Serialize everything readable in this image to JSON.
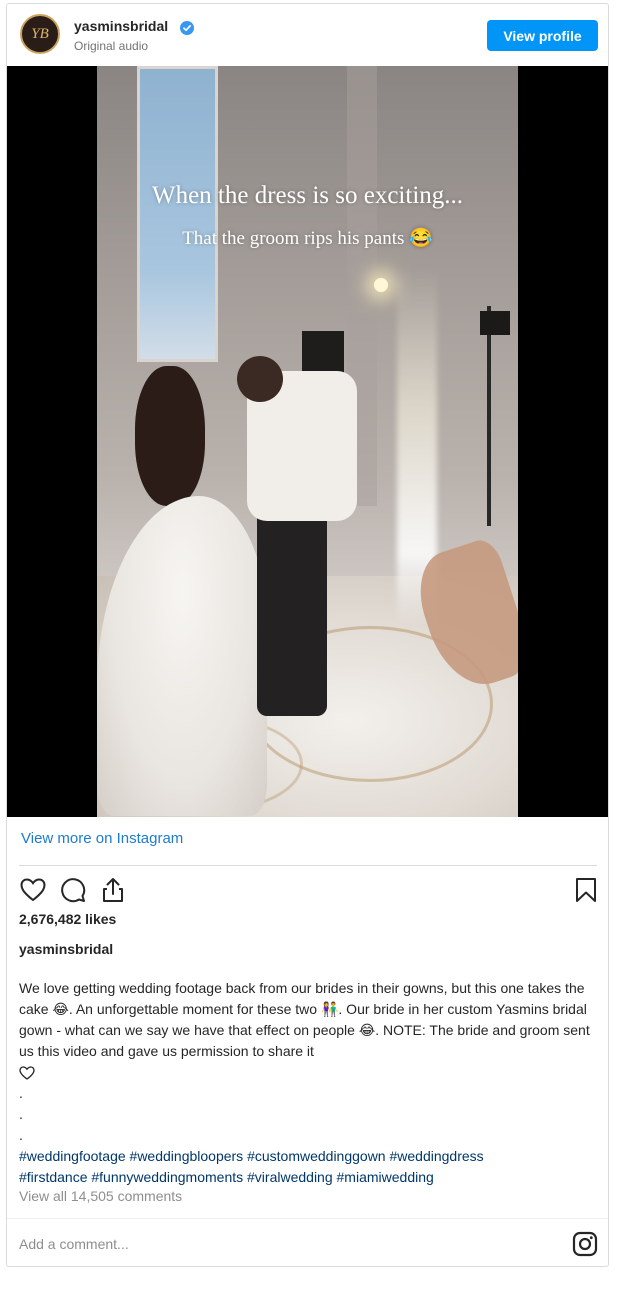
{
  "header": {
    "username": "yasminsbridal",
    "audio": "Original audio",
    "avatar_initials": "YB",
    "view_profile": "View profile"
  },
  "video": {
    "overlay_line1": "When the dress is so exciting...",
    "overlay_line2": "That the groom rips his pants 😂"
  },
  "view_more": "View more on Instagram",
  "post": {
    "likes": "2,676,482 likes",
    "caption_user": "yasminsbridal",
    "caption_line1": "We love getting wedding footage back from our brides in their gowns, but this one takes the cake 😂. An unforgettable moment for these two 👫. Our bride in her custom Yasmins bridal gown - what can we say we have that effect on people 😂. NOTE: The bride and groom sent us this video and gave us permission to share it",
    "dots": [
      ".",
      ".",
      "."
    ],
    "hashtags_line1": "#weddingfootage #weddingbloopers #customweddinggown #weddingdress",
    "hashtags_line2": "#firstdance #funnyweddingmoments #viralwedding #miamiwedding",
    "view_comments": "View all 14,505 comments"
  },
  "comment_box": {
    "placeholder": "Add a comment..."
  },
  "icons": {
    "like": "heart-icon",
    "comment": "comment-icon",
    "share": "share-icon",
    "save": "bookmark-icon",
    "instagram": "instagram-icon",
    "verified": "verified-badge-icon"
  },
  "colors": {
    "accent": "#0095f6",
    "link": "#1d7ccf",
    "hashtag": "#00376b"
  }
}
